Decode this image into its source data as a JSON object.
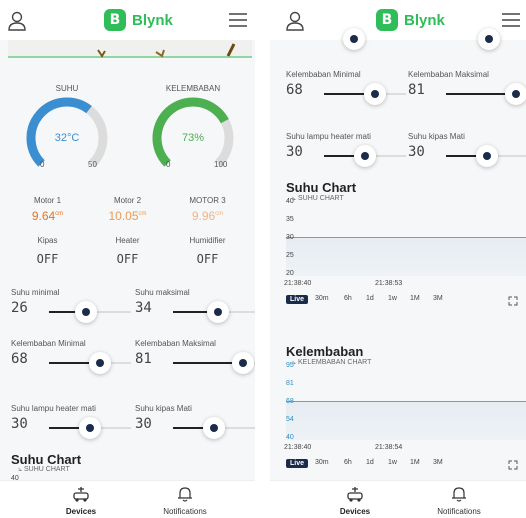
{
  "app": {
    "logo_letter": "B",
    "logo_text": "Blynk",
    "brand_color": "#2ebd59"
  },
  "left": {
    "gauges": [
      {
        "label": "SUHU",
        "value": "32°C",
        "min": "0",
        "max": "50",
        "level": 0.64,
        "color": "#3b8fd1"
      },
      {
        "label": "KELEMBABAN",
        "value": "73%",
        "min": "0",
        "max": "100",
        "level": 0.73,
        "color": "#4caf50"
      }
    ],
    "motors": [
      {
        "label": "Motor 1",
        "value": "9.64",
        "unit": "cm",
        "color": "#e0752b"
      },
      {
        "label": "Motor 2",
        "value": "10.05",
        "unit": "cm",
        "color": "#eb9a52"
      },
      {
        "label": "MOTOR 3",
        "value": "9.96",
        "unit": "cm",
        "color": "#f0b48a"
      }
    ],
    "switches": [
      {
        "label": "Kipas",
        "value": "OFF"
      },
      {
        "label": "Heater",
        "value": "OFF"
      },
      {
        "label": "Humidifier",
        "value": "OFF"
      }
    ],
    "sliders": [
      {
        "label": "Suhu minimal",
        "value": "26",
        "level": 0.45
      },
      {
        "label": "Suhu maksimal",
        "value": "34",
        "level": 0.55
      },
      {
        "label": "Kelembaban Minimal",
        "value": "68",
        "level": 0.62
      },
      {
        "label": "Kelembaban Maksimal",
        "value": "81",
        "level": 0.85
      },
      {
        "label": "Suhu lampu heater mati",
        "value": "30",
        "level": 0.5
      },
      {
        "label": "Suhu kipas Mati",
        "value": "30",
        "level": 0.5
      }
    ],
    "chart": {
      "title": "Suhu Chart",
      "subtitle": "SUHU CHART",
      "first_tick": "40"
    }
  },
  "right": {
    "sliders": [
      {
        "label": "Kelembaban Minimal",
        "value": "68",
        "level": 0.62
      },
      {
        "label": "Kelembaban Maksimal",
        "value": "81",
        "level": 0.85
      },
      {
        "label": "Suhu lampu heater mati",
        "value": "30",
        "level": 0.5
      },
      {
        "label": "Suhu kipas Mati",
        "value": "30",
        "level": 0.5
      }
    ],
    "charts": [
      {
        "title": "Suhu Chart",
        "subtitle": "SUHU CHART",
        "yticks": [
          "40",
          "35",
          "30",
          "25",
          "20"
        ],
        "xticks": [
          "21:38:40",
          "21:38:53"
        ],
        "tick_color": "#444"
      },
      {
        "title": "Kelembaban",
        "subtitle": "KELEMBABAN CHART",
        "yticks": [
          "95",
          "81",
          "68",
          "54",
          "40"
        ],
        "xticks": [
          "21:38:40",
          "21:38:54"
        ],
        "tick_color": "#2d8fc4"
      }
    ],
    "ranges": [
      "Live",
      "30m",
      "6h",
      "1d",
      "1w",
      "1M",
      "3M"
    ]
  },
  "nav": {
    "devices": "Devices",
    "notifications": "Notifications"
  }
}
